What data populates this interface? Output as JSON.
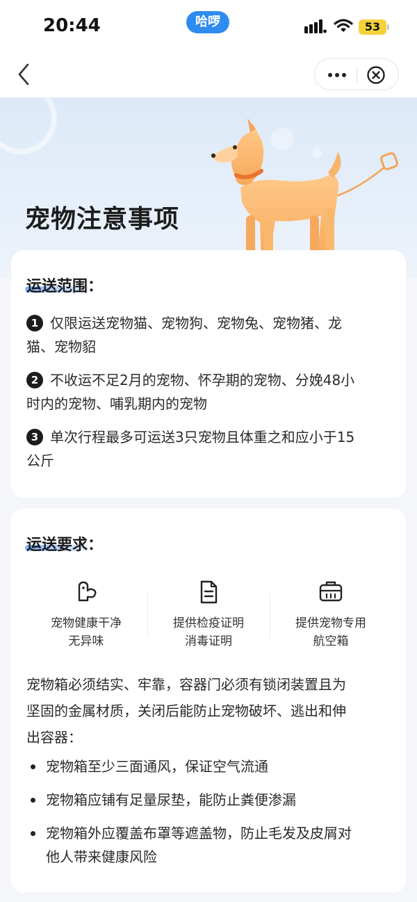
{
  "status_bar": {
    "time": "20:44",
    "app_pill": "哈啰",
    "battery": "53",
    "colors": {
      "pill": "#2e8cf0",
      "battery": "#f5d23a"
    }
  },
  "nav": {
    "back_icon": "chevron-left-icon",
    "more_icon": "more-dots-icon",
    "close_icon": "close-circle-icon"
  },
  "hero": {
    "title": "宠物注意事项",
    "illustration": "dog-with-leash"
  },
  "range_section": {
    "title": "运送范围：",
    "items": [
      {
        "badge": "1",
        "lines": [
          "仅限运送宠物猫、宠物狗、宠物兔、宠物猪、龙",
          "猫、宠物貂"
        ]
      },
      {
        "badge": "2",
        "lines": [
          "不收运不足2月的宠物、怀孕期的宠物、分娩48小",
          "时内的宠物、哺乳期内的宠物"
        ]
      },
      {
        "badge": "3",
        "lines": [
          "单次行程最多可运送3只宠物且体重之和应小于15",
          "公斤"
        ]
      }
    ]
  },
  "requirements_section": {
    "title": "运送要求：",
    "features": [
      {
        "icon": "pet-face-icon",
        "line1": "宠物健康干净",
        "line2": "无异味"
      },
      {
        "icon": "document-icon",
        "line1": "提供检疫证明",
        "line2": "消毒证明"
      },
      {
        "icon": "pet-carrier-icon",
        "line1": "提供宠物专用",
        "line2": "航空箱"
      }
    ],
    "paragraph_lines": [
      "宠物箱必须结实、牢靠，容器门必须有锁闭装置且为",
      "坚固的金属材质，关闭后能防止宠物破坏、逃出和伸",
      "出容器："
    ],
    "bullets": [
      {
        "lines": [
          "宠物箱至少三面通风，保证空气流通"
        ]
      },
      {
        "lines": [
          "宠物箱应铺有足量尿垫，能防止粪便渗漏"
        ]
      },
      {
        "lines": [
          "宠物箱外应覆盖布罩等遮盖物，防止毛发及皮屑对",
          "他人带来健康风险"
        ]
      }
    ]
  }
}
